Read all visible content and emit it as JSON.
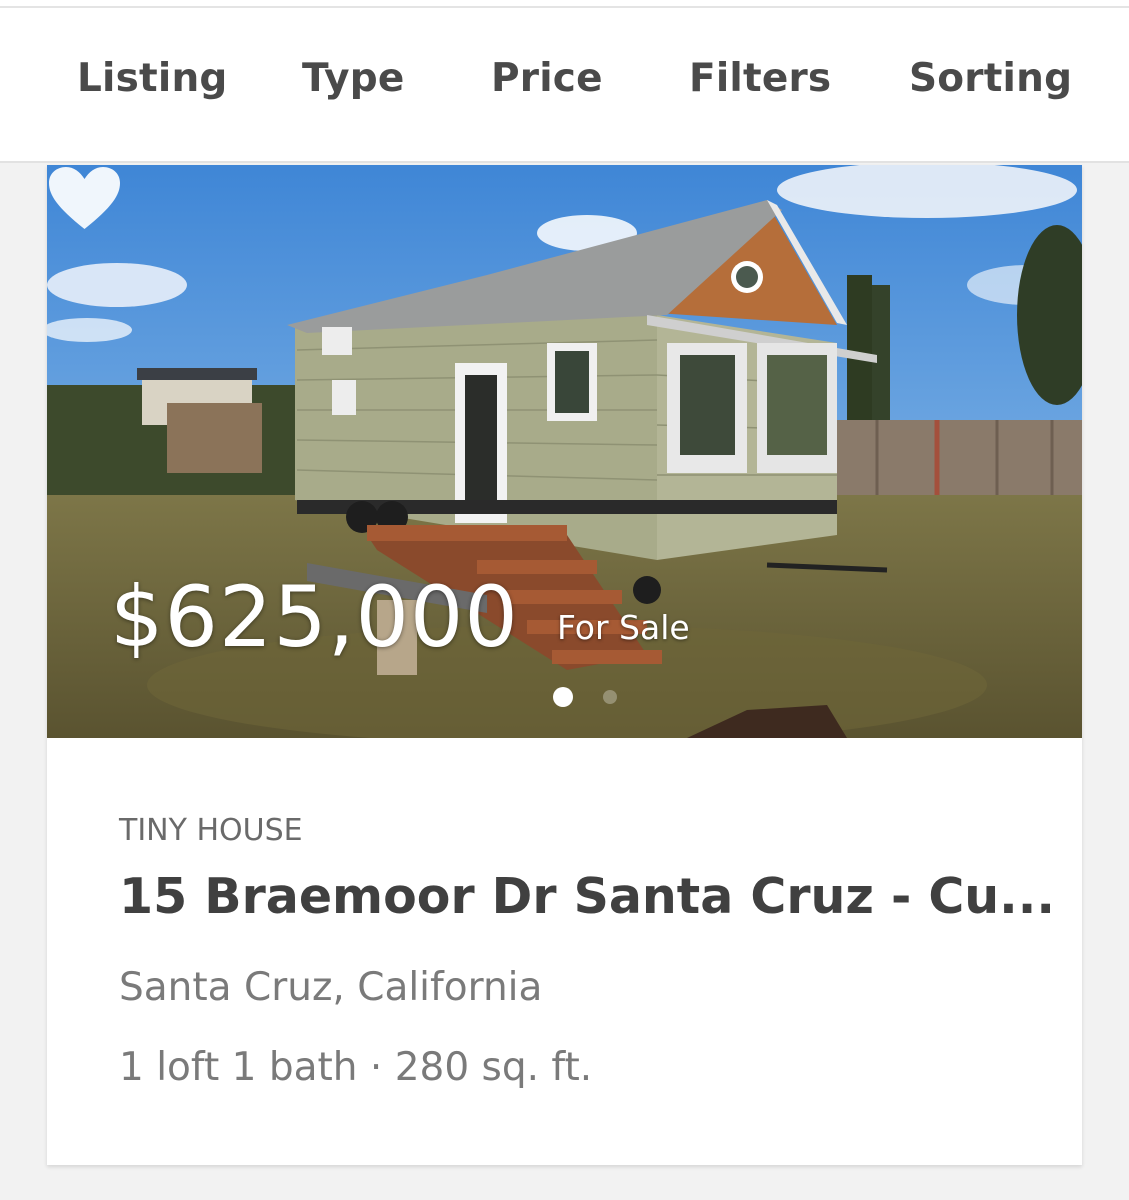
{
  "tabs": [
    {
      "label": "Listing"
    },
    {
      "label": "Type"
    },
    {
      "label": "Price"
    },
    {
      "label": "Filters"
    },
    {
      "label": "Sorting"
    }
  ],
  "listing": {
    "price": "$625,000",
    "status": "For Sale",
    "type": "TINY HOUSE",
    "title": "15 Braemoor Dr Santa Cruz - Cu...",
    "location": "Santa Cruz, California",
    "details": "1 loft 1 bath · 280 sq. ft.",
    "favorite_icon": "heart-icon",
    "photo_count_visible": 2,
    "active_photo": 1
  },
  "colors": {
    "text_dark": "#404040",
    "text_muted": "#7a7a7a",
    "tab_text": "#4a4a4a",
    "background": "#f2f2f2"
  }
}
